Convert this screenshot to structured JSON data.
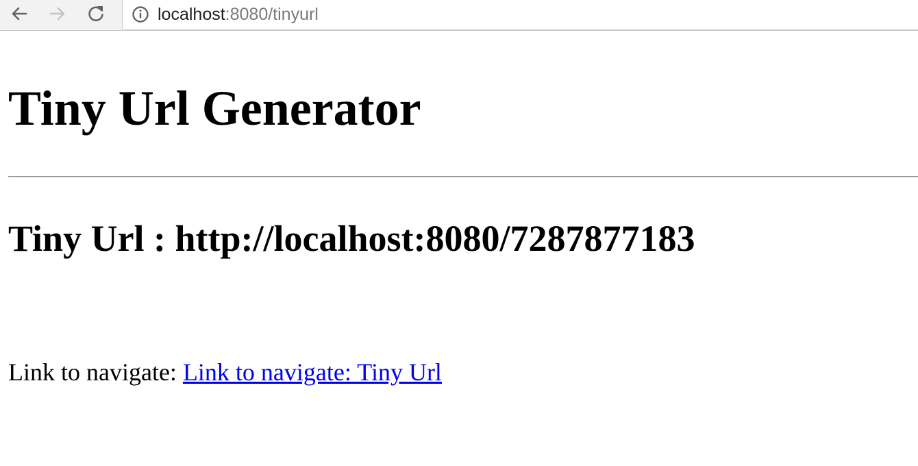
{
  "browser": {
    "url_host": "localhost",
    "url_rest": ":8080/tinyurl"
  },
  "icons": {
    "back": "arrow-left-icon",
    "forward": "arrow-right-icon",
    "reload": "reload-icon",
    "info": "info-icon"
  },
  "page": {
    "title": "Tiny Url Generator",
    "tiny_url_label": "Tiny Url : http://localhost:8080/7287877183",
    "nav_prefix": "Link to navigate: ",
    "nav_link_text": "Link to navigate: Tiny Url"
  },
  "colors": {
    "link": "#0000ee",
    "text": "#000000",
    "toolbar": "#f2f2f2"
  }
}
